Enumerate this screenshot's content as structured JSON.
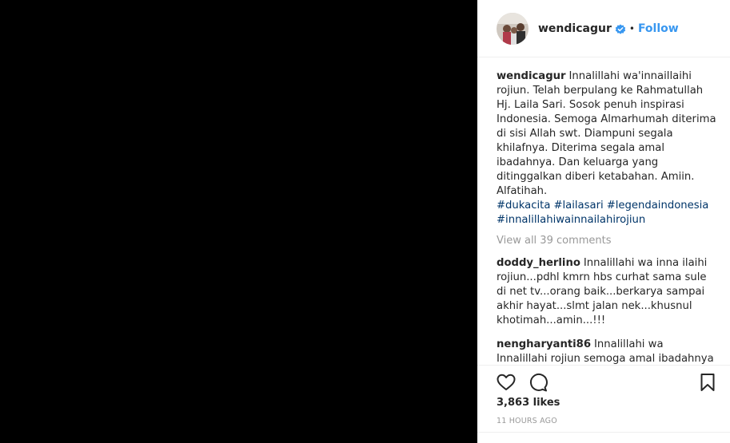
{
  "post": {
    "username": "wendicagur",
    "dot": "•",
    "follow_label": "Follow",
    "caption": "Innalillahi wa'innaillaihi rojiun. Telah berpulang ke Rahmatullah Hj. Laila Sari. Sosok penuh inspirasi Indonesia. Semoga Almarhumah diterima di sisi Allah swt. Diampuni segala khilafnya. Diterima segala amal ibadahnya. Dan keluarga yang ditinggalkan diberi ketabahan. Amiin. Alfatihah.",
    "hashtags": [
      "#dukacita",
      "#lailasari",
      "#legendaindonesia",
      "#innalillahiwainnailahirojiun"
    ],
    "view_all": "View all 39 comments",
    "comments": [
      {
        "user": "doddy_herlino",
        "text": "Innalillahi wa inna ilaihi rojiun...pdhl kmrn hbs curhat sama sule di net tv...orang baik...berkarya sampai akhir hayat...slmt jalan nek...khusnul khotimah...amin...!!!"
      },
      {
        "user": "nengharyanti86",
        "text": "Innalillahi wa Innalillahi rojiun semoga amal ibadahnya diterima di sisi ALLAH SWT dan di tempatkan di"
      }
    ],
    "likes": "3,863 likes",
    "time": "11 HOURS AGO"
  },
  "colors": {
    "follow": "#3897f0",
    "hashtag": "#003569",
    "muted": "#999999",
    "verified": "#3897f0"
  },
  "icons": [
    "verified-badge-icon",
    "heart-icon",
    "comment-icon",
    "bookmark-icon"
  ]
}
